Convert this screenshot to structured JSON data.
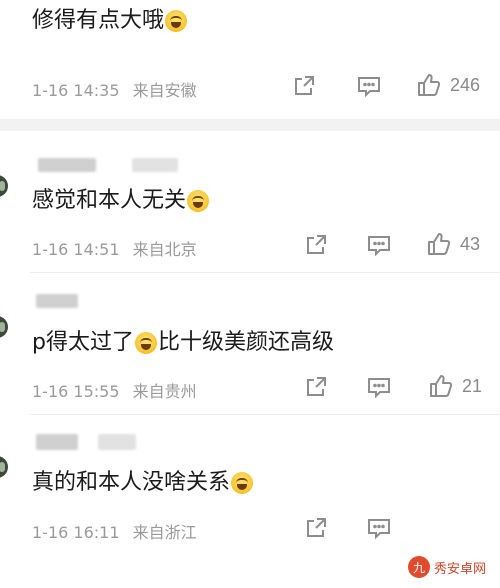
{
  "comments": [
    {
      "text": "修得有点大哦",
      "emoji_after": true,
      "time": "1-16 14:35",
      "location": "来自安徽",
      "likes": "246",
      "has_username": false
    },
    {
      "text": "感觉和本人无关",
      "emoji_after": true,
      "time": "1-16 14:51",
      "location": "来自北京",
      "likes": "43",
      "has_username": true
    },
    {
      "text_before": "p得太过了",
      "text_after": "比十级美颜还高级",
      "time": "1-16 15:55",
      "location": "来自贵州",
      "likes": "21",
      "has_username": true
    },
    {
      "text": "真的和本人没啥关系",
      "emoji_after": true,
      "time": "1-16 16:11",
      "location": "来自浙江",
      "likes": "",
      "has_username": true
    }
  ],
  "icons": {
    "share": "share-icon",
    "comment": "comment-icon",
    "like": "thumbs-up-icon",
    "emoji": "laughing-emoji-icon"
  },
  "watermark": {
    "logo_char": "九",
    "text": "秀安卓网"
  }
}
